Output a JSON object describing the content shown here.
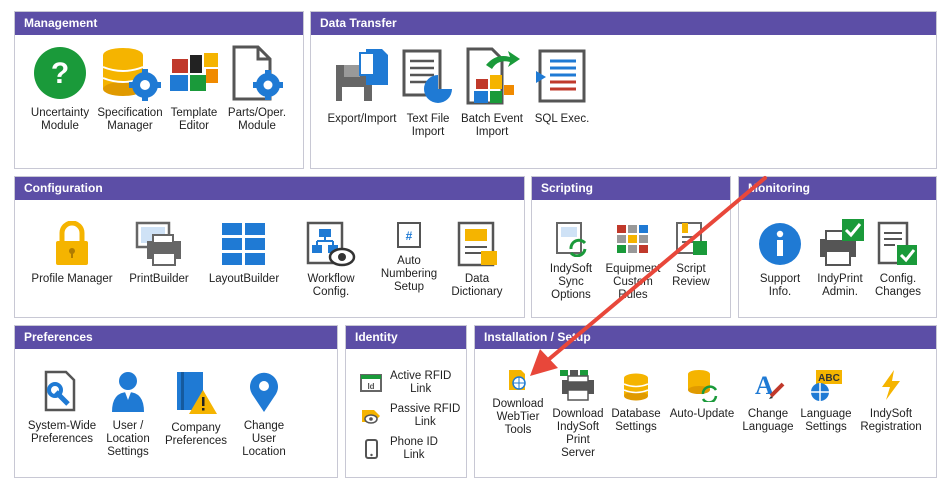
{
  "panels": {
    "management": {
      "title": "Management",
      "items": [
        {
          "label": "Uncertainty\nModule",
          "icon": "question-icon"
        },
        {
          "label": "Specification\nManager",
          "icon": "database-gear-icon"
        },
        {
          "label": "Template\nEditor",
          "icon": "blocks-icon"
        },
        {
          "label": "Parts/Oper.\nModule",
          "icon": "document-gear-icon"
        }
      ]
    },
    "data_transfer": {
      "title": "Data Transfer",
      "items": [
        {
          "label": "Export/Import",
          "icon": "export-import-icon"
        },
        {
          "label": "Text File\nImport",
          "icon": "text-file-import-icon"
        },
        {
          "label": "Batch Event\nImport",
          "icon": "batch-event-import-icon"
        },
        {
          "label": "SQL Exec.",
          "icon": "sql-exec-icon"
        }
      ]
    },
    "configuration": {
      "title": "Configuration",
      "items": [
        {
          "label": "Profile Manager",
          "icon": "lock-icon"
        },
        {
          "label": "PrintBuilder",
          "icon": "printer-icon"
        },
        {
          "label": "LayoutBuilder",
          "icon": "layout-grid-icon"
        },
        {
          "label": "Workflow\nConfig.",
          "icon": "workflow-icon"
        },
        {
          "label": "Auto\nNumbering\nSetup",
          "icon": "numbering-icon"
        },
        {
          "label": "Data\nDictionary",
          "icon": "dictionary-icon"
        }
      ]
    },
    "scripting": {
      "title": "Scripting",
      "items": [
        {
          "label": "IndySoft\nSync\nOptions",
          "icon": "sync-icon"
        },
        {
          "label": "Equipment\nCustom\nRules",
          "icon": "custom-rules-icon"
        },
        {
          "label": "Script\nReview",
          "icon": "script-review-icon"
        }
      ]
    },
    "monitoring": {
      "title": "Monitoring",
      "items": [
        {
          "label": "Support\nInfo.",
          "icon": "info-icon"
        },
        {
          "label": "IndyPrint\nAdmin.",
          "icon": "printer-check-icon"
        },
        {
          "label": "Config.\nChanges",
          "icon": "document-check-icon"
        }
      ]
    },
    "preferences": {
      "title": "Preferences",
      "items": [
        {
          "label": "System-Wide\nPreferences",
          "icon": "document-wrench-icon"
        },
        {
          "label": "User /\nLocation\nSettings",
          "icon": "user-icon"
        },
        {
          "label": "Company\nPreferences",
          "icon": "book-warning-icon"
        },
        {
          "label": "Change\nUser\nLocation",
          "icon": "map-pin-icon"
        }
      ]
    },
    "identity": {
      "title": "Identity",
      "items": [
        {
          "label": "Active RFID\nLink",
          "icon": "id-card-icon"
        },
        {
          "label": "Passive RFID\nLink",
          "icon": "rfid-tag-icon"
        },
        {
          "label": "Phone ID\nLink",
          "icon": "phone-icon"
        }
      ]
    },
    "installation": {
      "title": "Installation / Setup",
      "items": [
        {
          "label": "Download\nWebTier\nTools",
          "icon": "web-document-icon"
        },
        {
          "label": "Download\nIndySoft\nPrint\nServer",
          "icon": "print-server-icon"
        },
        {
          "label": "Database\nSettings",
          "icon": "database-icon"
        },
        {
          "label": "Auto-Update",
          "icon": "database-sync-icon"
        },
        {
          "label": "Change\nLanguage",
          "icon": "letter-pen-icon"
        },
        {
          "label": "Language\nSettings",
          "icon": "abc-globe-icon"
        },
        {
          "label": "IndySoft\nRegistration",
          "icon": "lightning-icon"
        }
      ]
    }
  },
  "colors": {
    "header": "#5c4ea6",
    "annotation_arrow": "#e8473a",
    "icon_blue": "#1f7ad4",
    "icon_green": "#1a9a3a",
    "icon_yellow": "#f5b400"
  }
}
